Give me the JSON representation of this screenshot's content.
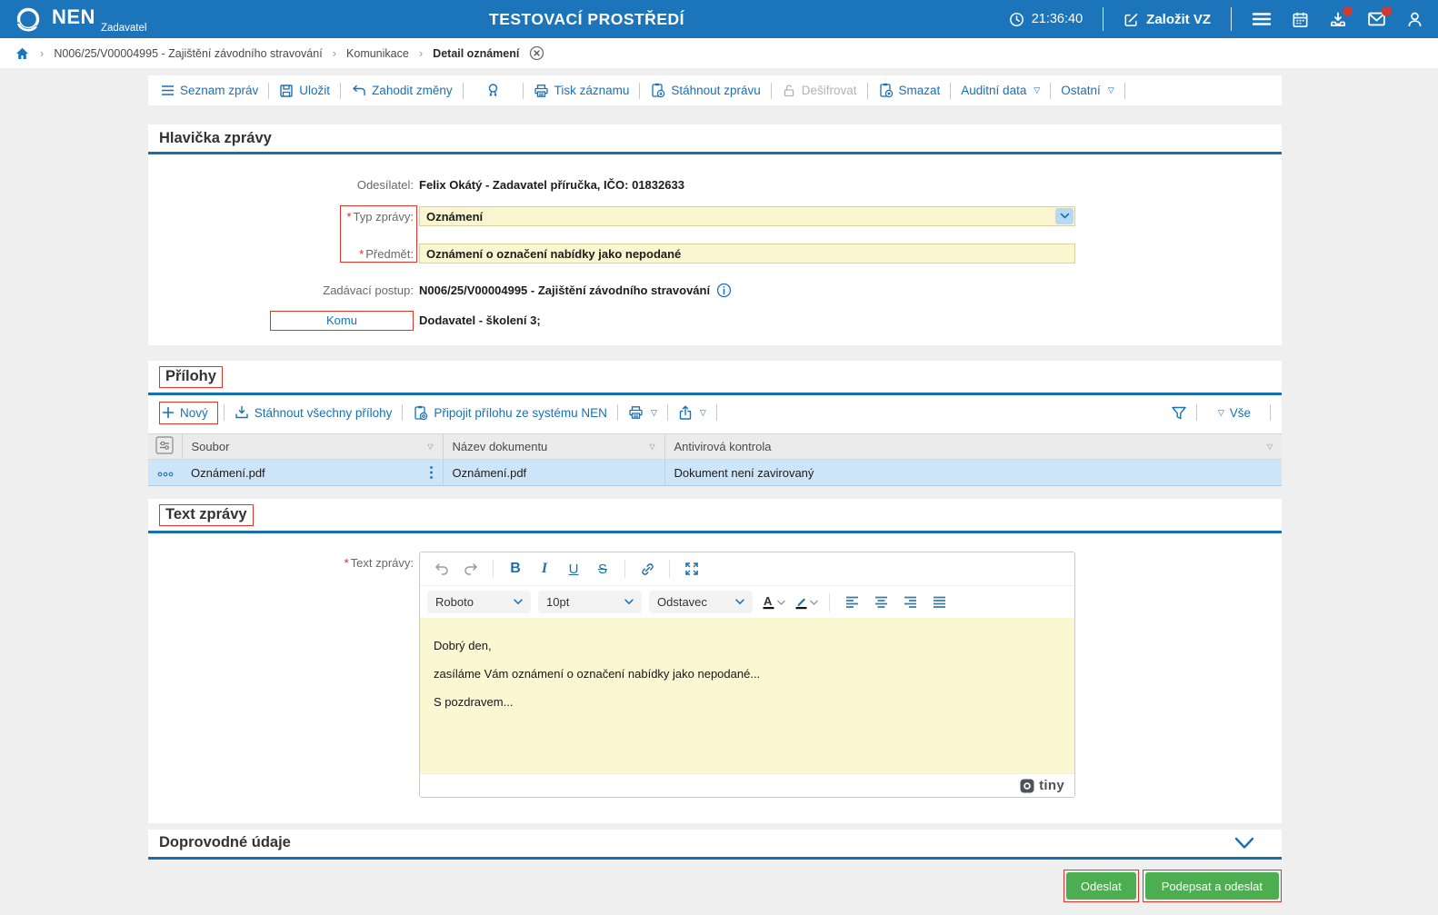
{
  "header": {
    "logo_text": "NEN",
    "logo_sub": "Zadavatel",
    "env_title": "TESTOVACÍ PROSTŘEDÍ",
    "time": "21:36:40",
    "create_vz_label": "Založit VZ"
  },
  "breadcrumb": {
    "items": [
      "N006/25/V00004995 - Zajištění závodního stravování",
      "Komunikace",
      "Detail oznámení"
    ]
  },
  "toolbar": {
    "items": [
      {
        "label": "Seznam zpráv"
      },
      {
        "label": "Uložit"
      },
      {
        "label": "Zahodit změny"
      },
      {
        "label": "Tisk záznamu"
      },
      {
        "label": "Stáhnout zprávu"
      },
      {
        "label": "Dešifrovat"
      },
      {
        "label": "Smazat"
      },
      {
        "label": "Auditní data"
      },
      {
        "label": "Ostatní"
      }
    ]
  },
  "message_header": {
    "title": "Hlavička zprávy",
    "required_mark": "*",
    "sender_label": "Odesílatel:",
    "sender_value": "Felix Okátý - Zadavatel příručka, IČO: 01832633",
    "type_label": "Typ zprávy:",
    "type_value": "Oznámení",
    "subject_label": "Předmět:",
    "subject_value": "Oznámení o označení nabídky jako nepodané",
    "procedure_label": "Zadávací postup:",
    "procedure_value": "N006/25/V00004995 - Zajištění závodního stravování",
    "to_label": "Komu",
    "to_value": "Dodavatel - školení 3;"
  },
  "attachments": {
    "title": "Přílohy",
    "toolbar": {
      "new_label": "Nový",
      "download_all_label": "Stáhnout všechny přílohy",
      "attach_nen_label": "Připojit přílohu ze systému NEN",
      "all_label": "Vše"
    },
    "table": {
      "columns": [
        "Soubor",
        "Název dokumentu",
        "Antivirová kontrola"
      ],
      "rows": [
        {
          "file": "Oznámení.pdf",
          "doc_name": "Oznámení.pdf",
          "antivirus": "Dokument není zavirovaný"
        }
      ]
    }
  },
  "message_body": {
    "title": "Text zprávy",
    "required_mark": "*",
    "field_label": "Text zprávy:",
    "editor": {
      "font_name": "Roboto",
      "font_size": "10pt",
      "block_format": "Odstavec",
      "lines": [
        "Dobrý den,",
        "zasíláme Vám oznámení o označení nabídky jako nepodané...",
        "S pozdravem..."
      ],
      "brand": "tiny"
    }
  },
  "footer": {
    "section_title": "Doprovodné údaje",
    "send_label": "Odeslat",
    "sign_send_label": "Podepsat a odeslat"
  },
  "colors": {
    "header_blue": "#1c75ba",
    "accent_blue": "#1871b8",
    "section_underline": "#1670ae",
    "annotation_red": "#e0352b",
    "button_green": "#4cae50",
    "field_yellow": "#faf6d0",
    "row_highlight": "#cde5f8"
  }
}
